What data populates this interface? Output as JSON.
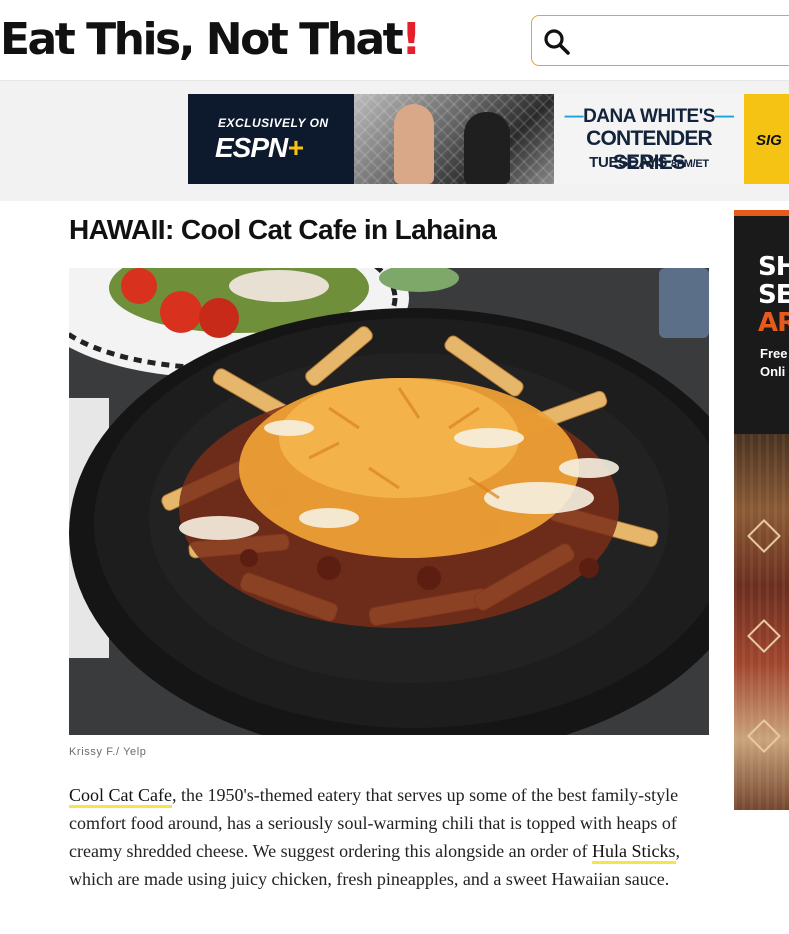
{
  "header": {
    "logo_text": "Eat This, Not That",
    "logo_bang": "!",
    "search_placeholder": ""
  },
  "banner_ad": {
    "exclusively_on": "EXCLUSIVELY ON",
    "espn_logo": "ESPN",
    "espn_plus": "+",
    "line1_left_dash": "—",
    "line1": "DANA WHITE'S",
    "line1_right_dash": "—",
    "line2": "CONTENDER SERIES",
    "line3": "TUESDAYS",
    "line3_time": "8PM/ET",
    "cta": "SIG"
  },
  "article": {
    "headline": "HAWAII: Cool Cat Cafe in Lahaina",
    "photo_credit": "Krissy F./ Yelp",
    "body": {
      "link1": "Cool Cat Cafe",
      "text1": ", the 1950's-themed eatery that serves up some of the best family-style comfort food around, has a seriously soul-warming chili that is topped with heaps of creamy shredded cheese. We suggest ordering this alongside an order of ",
      "link2": "Hula Sticks",
      "text2": ", which are made using juicy chicken, fresh pineapples, and a sweet Hawaiian sauce."
    }
  },
  "side_ad": {
    "line1": "SH",
    "line2": "SE",
    "line3": "AR",
    "sub1": "Free",
    "sub2": "Onli"
  },
  "colors": {
    "logo_bang": "#e4212b",
    "search_border": "#e2a33a",
    "link_underline": "#f7e34a",
    "espn_plus": "#f4c313",
    "side_ad_accent": "#e65b1b"
  },
  "icons": {
    "search": "search-icon"
  }
}
